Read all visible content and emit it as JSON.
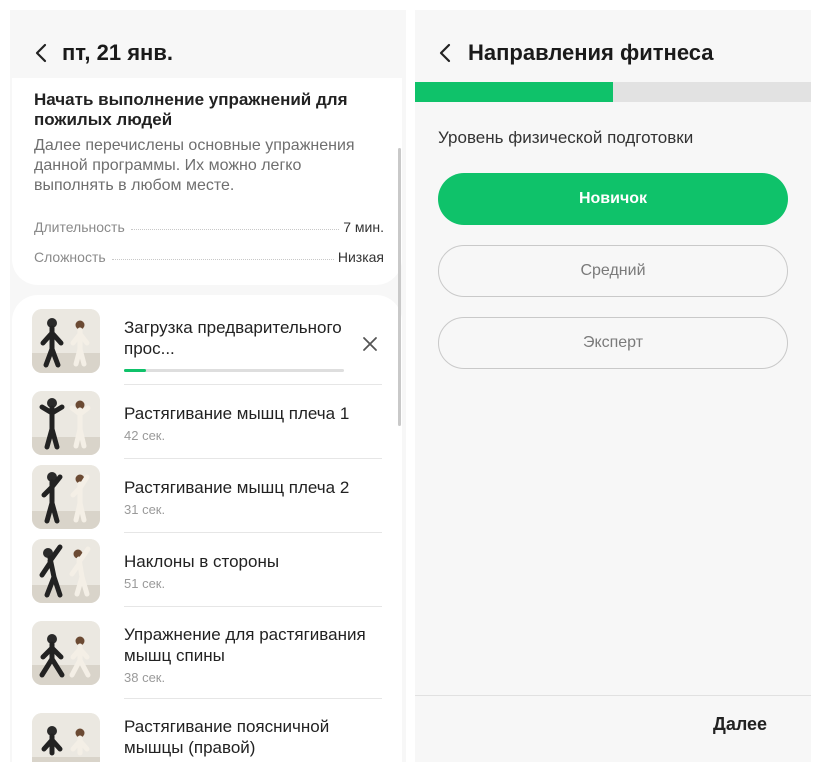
{
  "left_screen": {
    "header": {
      "title": "пт, 21 янв."
    },
    "program": {
      "title": "Начать выполнение упражнений для пожилых людей",
      "description": "Далее перечислены основные упражнения данной программы. Их можно легко выполнять в любом месте.",
      "duration_label": "Длительность",
      "duration_value": "7 мин.",
      "difficulty_label": "Сложность",
      "difficulty_value": "Низкая"
    },
    "exercises": [
      {
        "name": "Загрузка предварительного прос...",
        "duration": "",
        "download_progress": 0.1
      },
      {
        "name": "Растягивание мышц плеча 1",
        "duration": "42 сек."
      },
      {
        "name": "Растягивание мышц плеча 2",
        "duration": "31 сек."
      },
      {
        "name": "Наклоны в стороны",
        "duration": "51 сек."
      },
      {
        "name": "Упражнение для растягивания мышц спины",
        "duration": "38 сек."
      },
      {
        "name": "Растягивание поясничной мышцы (правой)",
        "duration": ""
      }
    ]
  },
  "right_screen": {
    "header": {
      "title": "Направления фитнеса"
    },
    "step_progress": 0.5,
    "question": "Уровень физической подготовки",
    "options": [
      {
        "label": "Новичок",
        "selected": true
      },
      {
        "label": "Средний",
        "selected": false
      },
      {
        "label": "Эксперт",
        "selected": false
      }
    ],
    "next_label": "Далее"
  },
  "colors": {
    "accent": "#0fc26a",
    "panel_bg": "#f7f7f7",
    "card_bg": "#ffffff",
    "track": "#e2e2e2"
  },
  "icons": {
    "back": "chevron-left-icon",
    "close": "close-icon"
  }
}
